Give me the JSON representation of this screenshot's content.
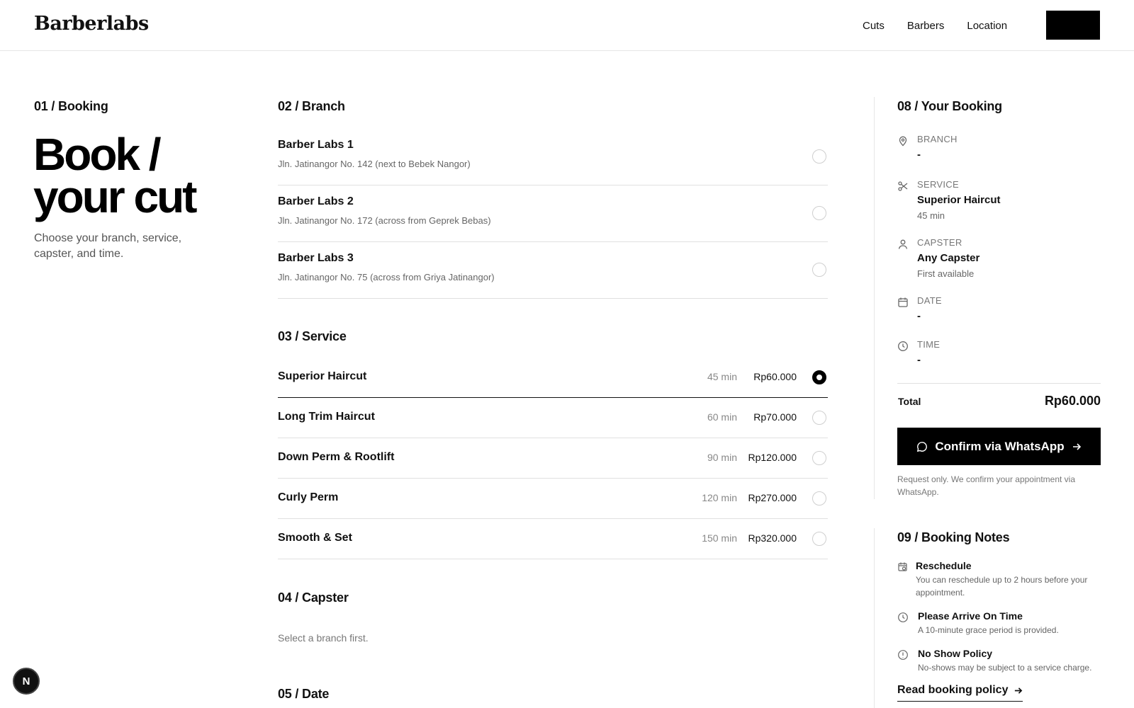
{
  "header": {
    "logo": "Barberlabs",
    "nav": [
      "Cuts",
      "Barbers",
      "Location"
    ]
  },
  "left": {
    "label": "01 / Booking",
    "hero_line1": "Book /",
    "hero_line2": "your cut",
    "subtitle": "Choose your branch, service, capster, and time."
  },
  "branch": {
    "label": "02 / Branch",
    "items": [
      {
        "name": "Barber Labs 1",
        "address": "Jln. Jatinangor No. 142 (next to Bebek Nangor)"
      },
      {
        "name": "Barber Labs 2",
        "address": "Jln. Jatinangor No. 172 (across from Geprek Bebas)"
      },
      {
        "name": "Barber Labs 3",
        "address": "Jln. Jatinangor No. 75 (across from Griya Jatinangor)"
      }
    ]
  },
  "service": {
    "label": "03 / Service",
    "items": [
      {
        "name": "Superior Haircut",
        "duration": "45 min",
        "price": "Rp60.000",
        "selected": true
      },
      {
        "name": "Long Trim Haircut",
        "duration": "60 min",
        "price": "Rp70.000",
        "selected": false
      },
      {
        "name": "Down Perm & Rootlift",
        "duration": "90 min",
        "price": "Rp120.000",
        "selected": false
      },
      {
        "name": "Curly Perm",
        "duration": "120 min",
        "price": "Rp270.000",
        "selected": false
      },
      {
        "name": "Smooth & Set",
        "duration": "150 min",
        "price": "Rp320.000",
        "selected": false
      }
    ]
  },
  "capster": {
    "label": "04 / Capster",
    "hint": "Select a branch first."
  },
  "date": {
    "label": "05 / Date"
  },
  "summary": {
    "label": "08 / Your Booking",
    "branch": {
      "key": "BRANCH",
      "value": "-"
    },
    "service": {
      "key": "SERVICE",
      "value": "Superior Haircut",
      "sub": "45 min"
    },
    "capster": {
      "key": "CAPSTER",
      "value": "Any Capster",
      "sub": "First available"
    },
    "date": {
      "key": "DATE",
      "value": "-"
    },
    "time": {
      "key": "TIME",
      "value": "-"
    },
    "total_label": "Total",
    "total_value": "Rp60.000",
    "confirm_label": "Confirm via WhatsApp",
    "note": "Request only. We confirm your appointment via WhatsApp."
  },
  "notes": {
    "label": "09 / Booking Notes",
    "items": [
      {
        "title": "Reschedule",
        "desc": "You can reschedule up to 2 hours before your appointment."
      },
      {
        "title": "Please Arrive On Time",
        "desc": "A 10-minute grace period is provided."
      },
      {
        "title": "No Show Policy",
        "desc": "No-shows may be subject to a service charge."
      }
    ],
    "link": "Read booking policy"
  },
  "fab": {
    "letter": "N"
  },
  "colors": {
    "accent": "#000000",
    "border": "#e0e0e0",
    "muted": "#777777"
  }
}
